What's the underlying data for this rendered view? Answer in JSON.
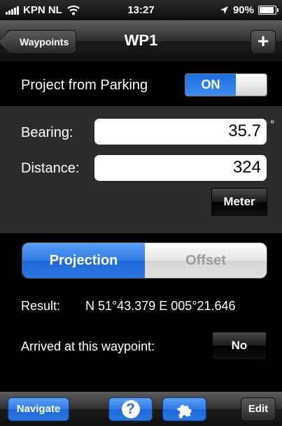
{
  "status_bar": {
    "carrier": "KPN NL",
    "time": "13:27",
    "battery": "90%",
    "battery_level": 0.9,
    "icons": [
      "signal-bars-icon",
      "wifi-icon",
      "location-arrow-icon",
      "battery-icon"
    ]
  },
  "nav_bar": {
    "back_label": "Waypoints",
    "title": "WP1",
    "add_label": "+"
  },
  "project": {
    "label": "Project from Parking",
    "toggle_value": "ON"
  },
  "bearing": {
    "label": "Bearing:",
    "value": "35.7",
    "unit": "°"
  },
  "distance": {
    "label": "Distance:",
    "value": "324",
    "unit_button": "Meter"
  },
  "mode_segment": {
    "options": [
      "Projection",
      "Offset"
    ],
    "selected": "Projection"
  },
  "result": {
    "label": "Result:",
    "value": "N 51°43.379 E 005°21.646"
  },
  "arrived": {
    "label": "Arrived at this waypoint:",
    "value": "No"
  },
  "toolbar": {
    "navigate_label": "Navigate",
    "help_label": "?",
    "edit_label": "Edit"
  },
  "colors": {
    "accent_blue": "#2f7ae6",
    "section_gray": "#2c2c2c",
    "background": "#000000"
  }
}
